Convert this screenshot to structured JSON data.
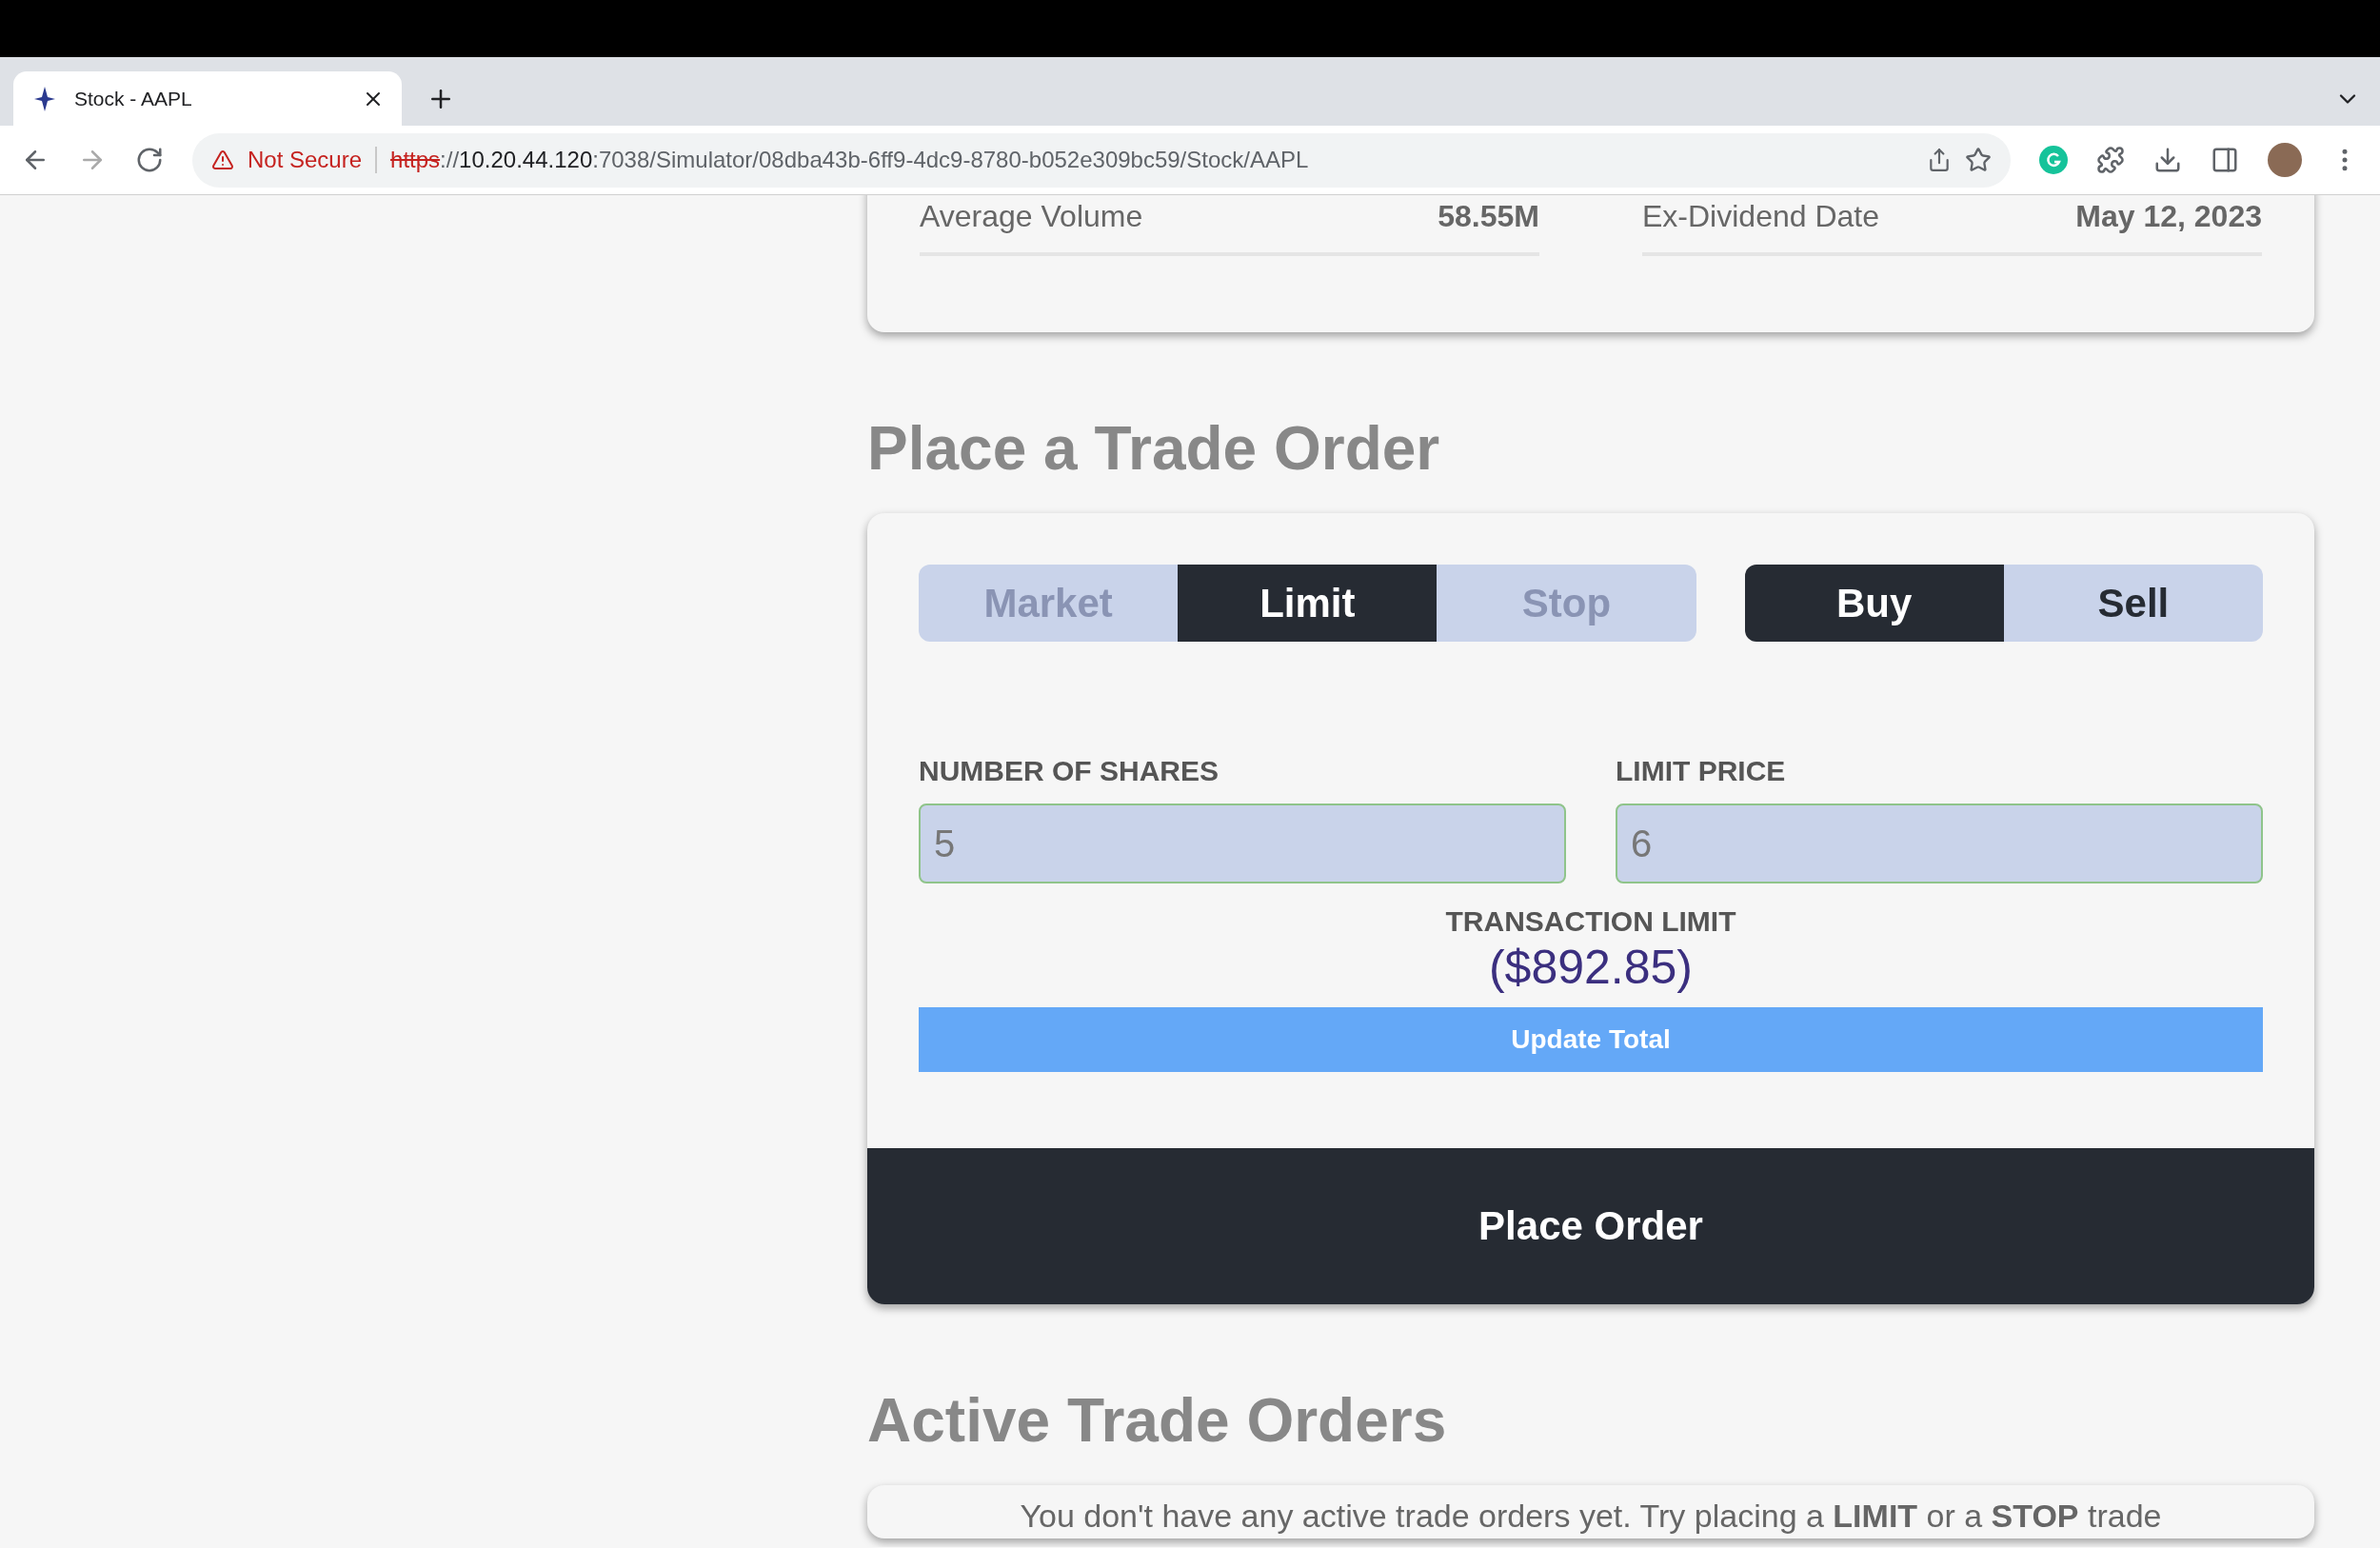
{
  "browser": {
    "tab_title": "Stock - AAPL",
    "security": "Not Secure",
    "scheme": "https",
    "separator": "://",
    "host": "10.20.44.120",
    "path": ":7038/Simulator/08dba43b-6ff9-4dc9-8780-b052e309bc59/Stock/AAPL"
  },
  "stats": [
    {
      "label": "Average Volume",
      "value": "58.55M"
    },
    {
      "label": "Ex-Dividend Date",
      "value": "May 12, 2023"
    }
  ],
  "trade": {
    "heading": "Place a Trade Order",
    "order_types": [
      {
        "label": "Market",
        "selected": false
      },
      {
        "label": "Limit",
        "selected": true
      },
      {
        "label": "Stop",
        "selected": false
      }
    ],
    "sides": [
      {
        "label": "Buy",
        "selected": true
      },
      {
        "label": "Sell",
        "selected": false
      }
    ],
    "fields": [
      {
        "label": "NUMBER OF SHARES",
        "value": "5"
      },
      {
        "label": "LIMIT PRICE",
        "value": "6"
      }
    ],
    "transaction_limit": {
      "label": "TRANSACTION LIMIT",
      "value": "($892.85)"
    },
    "update_button": "Update Total",
    "place_button": "Place Order"
  },
  "active": {
    "heading": "Active Trade Orders",
    "message": "You don't have any active trade orders yet. Try placing a **LIMIT** or a **STOP** trade"
  }
}
